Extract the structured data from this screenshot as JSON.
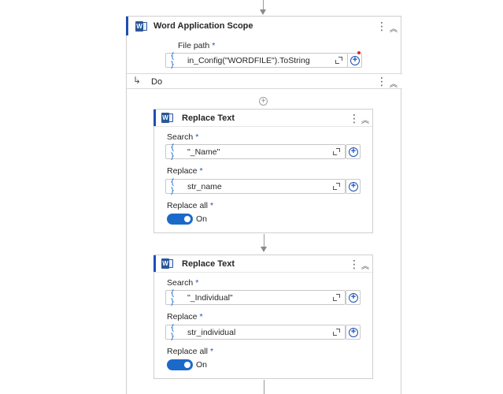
{
  "scope": {
    "title": "Word Application Scope",
    "file_path_label": "File path",
    "required_mark": "*",
    "file_path_value": "in_Config(\"WORDFILE\").ToString",
    "brace": "{ }",
    "do_label": "Do"
  },
  "activities": [
    {
      "title": "Replace Text",
      "search_label": "Search",
      "search_value": "\"_Name\"",
      "replace_label": "Replace",
      "replace_value": "str_name",
      "replace_all_label": "Replace all",
      "toggle_state": "On"
    },
    {
      "title": "Replace Text",
      "search_label": "Search",
      "search_value": "\"_Individual\"",
      "replace_label": "Replace",
      "replace_value": "str_individual",
      "replace_all_label": "Replace all",
      "toggle_state": "On"
    }
  ],
  "icons": {
    "word": "W",
    "kebab": "⋮",
    "collapse": "︽",
    "plus": "+",
    "do_arrow": "↳"
  },
  "colors": {
    "accent": "#1b4fb7",
    "toggle": "#1b6ac9",
    "required": "#1b4fb7",
    "error_dot": "#e02424"
  }
}
